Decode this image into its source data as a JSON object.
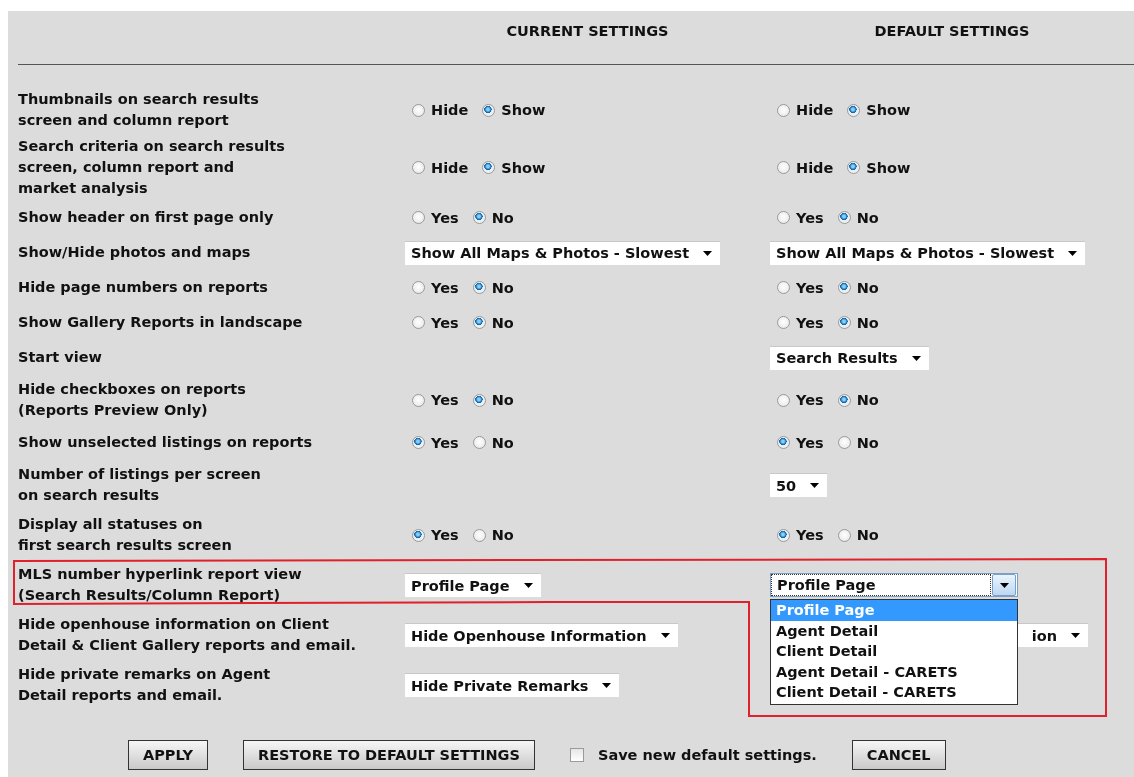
{
  "headers": {
    "current": "CURRENT SETTINGS",
    "default": "DEFAULT SETTINGS"
  },
  "settings": [
    {
      "label": "Thumbnails on search results\nscreen and column report",
      "current": {
        "kind": "radio",
        "options": [
          {
            "label": "Hide",
            "selected": false
          },
          {
            "label": "Show",
            "selected": true
          }
        ]
      },
      "default": {
        "kind": "radio",
        "options": [
          {
            "label": "Hide",
            "selected": false
          },
          {
            "label": "Show",
            "selected": true
          }
        ]
      }
    },
    {
      "label": "Search criteria on search results\nscreen, column report and\nmarket analysis",
      "current": {
        "kind": "radio",
        "options": [
          {
            "label": "Hide",
            "selected": false
          },
          {
            "label": "Show",
            "selected": true
          }
        ]
      },
      "default": {
        "kind": "radio",
        "options": [
          {
            "label": "Hide",
            "selected": false
          },
          {
            "label": "Show",
            "selected": true
          }
        ]
      }
    },
    {
      "label": "Show header on first page only",
      "current": {
        "kind": "radio",
        "options": [
          {
            "label": "Yes",
            "selected": false
          },
          {
            "label": "No",
            "selected": true
          }
        ]
      },
      "default": {
        "kind": "radio",
        "options": [
          {
            "label": "Yes",
            "selected": false
          },
          {
            "label": "No",
            "selected": true
          }
        ]
      }
    },
    {
      "label": "Show/Hide photos and maps",
      "current": {
        "kind": "select",
        "value": "Show All Maps & Photos - Slowest"
      },
      "default": {
        "kind": "select",
        "value": "Show All Maps & Photos - Slowest"
      }
    },
    {
      "label": "Hide page numbers on reports",
      "current": {
        "kind": "radio",
        "options": [
          {
            "label": "Yes",
            "selected": false
          },
          {
            "label": "No",
            "selected": true
          }
        ]
      },
      "default": {
        "kind": "radio",
        "options": [
          {
            "label": "Yes",
            "selected": false
          },
          {
            "label": "No",
            "selected": true
          }
        ]
      }
    },
    {
      "label": "Show Gallery Reports in landscape",
      "current": {
        "kind": "radio",
        "options": [
          {
            "label": "Yes",
            "selected": false
          },
          {
            "label": "No",
            "selected": true
          }
        ]
      },
      "default": {
        "kind": "radio",
        "options": [
          {
            "label": "Yes",
            "selected": false
          },
          {
            "label": "No",
            "selected": true
          }
        ]
      }
    },
    {
      "label": "Start view",
      "default": {
        "kind": "select",
        "value": "Search Results"
      }
    },
    {
      "label": "Hide checkboxes on reports\n(Reports Preview Only)",
      "current": {
        "kind": "radio",
        "options": [
          {
            "label": "Yes",
            "selected": false
          },
          {
            "label": "No",
            "selected": true
          }
        ]
      },
      "default": {
        "kind": "radio",
        "options": [
          {
            "label": "Yes",
            "selected": false
          },
          {
            "label": "No",
            "selected": true
          }
        ]
      }
    },
    {
      "label": "Show unselected listings on reports",
      "current": {
        "kind": "radio",
        "options": [
          {
            "label": "Yes",
            "selected": true
          },
          {
            "label": "No",
            "selected": false
          }
        ]
      },
      "default": {
        "kind": "radio",
        "options": [
          {
            "label": "Yes",
            "selected": true
          },
          {
            "label": "No",
            "selected": false
          }
        ]
      }
    },
    {
      "label": "Number of listings per screen\non search results",
      "default": {
        "kind": "select",
        "value": "50"
      }
    },
    {
      "label": "Display all statuses on\nfirst search results screen",
      "current": {
        "kind": "radio",
        "options": [
          {
            "label": "Yes",
            "selected": true
          },
          {
            "label": "No",
            "selected": false
          }
        ]
      },
      "default": {
        "kind": "radio",
        "options": [
          {
            "label": "Yes",
            "selected": true
          },
          {
            "label": "No",
            "selected": false
          }
        ]
      }
    },
    {
      "label": "MLS number hyperlink report view\n(Search Results/Column Report)",
      "current": {
        "kind": "select",
        "value": "Profile Page"
      },
      "default": {
        "kind": "select",
        "value": "Profile Page",
        "expanded": true,
        "options": [
          {
            "label": "Profile Page",
            "selected": true
          },
          {
            "label": "Agent Detail",
            "selected": false
          },
          {
            "label": "Client Detail",
            "selected": false
          },
          {
            "label": "Agent Detail - CARETS",
            "selected": false
          },
          {
            "label": "Client Detail - CARETS",
            "selected": false
          }
        ]
      }
    },
    {
      "label": "Hide openhouse information on Client\nDetail & Client Gallery reports and email.",
      "current": {
        "kind": "select",
        "value": "Hide Openhouse Information"
      },
      "default": {
        "kind": "select",
        "value": "ion",
        "covered": true
      }
    },
    {
      "label": "Hide private remarks on Agent\nDetail reports and email.",
      "current": {
        "kind": "select",
        "value": "Hide Private Remarks"
      }
    }
  ],
  "footer": [
    {
      "kind": "button",
      "label": "APPLY"
    },
    {
      "kind": "button",
      "label": "RESTORE TO DEFAULT SETTINGS"
    },
    {
      "kind": "checkbox",
      "label": "Save new default settings.",
      "checked": false
    },
    {
      "kind": "button",
      "label": "CANCEL"
    }
  ]
}
